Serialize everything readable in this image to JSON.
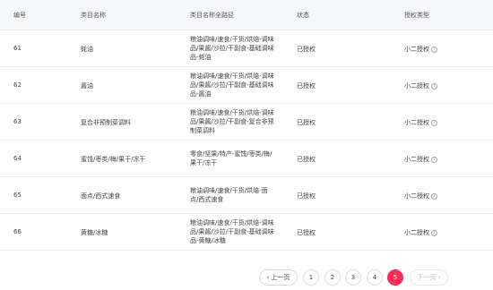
{
  "headers": {
    "id": "编号",
    "name": "类目名称",
    "path": "类目名称全路径",
    "status": "状态",
    "auth": "授权类型"
  },
  "rows": [
    {
      "id": "61",
      "name": "蚝油",
      "path_lines": [
        "粮油调味/速食/干货/烘焙-调味",
        "品/果酱/沙拉/干副食-基础调味",
        "品-蚝油"
      ],
      "status": "已授权",
      "auth": "小二授权"
    },
    {
      "id": "62",
      "name": "酱油",
      "path_lines": [
        "粮油调味/速食/干货/烘焙-调味",
        "品/果酱/沙拉/干副食-基础调味",
        "品-酱油"
      ],
      "status": "已授权",
      "auth": "小二授权"
    },
    {
      "id": "63",
      "name": "复合非预制菜调料",
      "path_lines": [
        "粮油调味/速食/干货/烘焙-调味",
        "品/果酱/沙拉/干副食-复合非预",
        "制菜调料"
      ],
      "status": "已授权",
      "auth": "小二授权"
    },
    {
      "id": "64",
      "name": "蜜饯/枣类/梅/果干/冻干",
      "path_lines": [
        "零食/坚果/特产-蜜饯/枣类/梅/",
        "果干/冻干"
      ],
      "status": "已授权",
      "auth": "小二授权"
    },
    {
      "id": "65",
      "name": "面点/西式速食",
      "path_lines": [
        "粮油调味/速食/干货/烘焙-面",
        "点/西式速食"
      ],
      "status": "已授权",
      "auth": "小二授权"
    },
    {
      "id": "66",
      "name": "黄糖/冰糖",
      "path_lines": [
        "粮油调味/速食/干货/烘焙-调味",
        "品/果酱/沙拉/干副食-基础调味",
        "品-黄糖/冰糖"
      ],
      "status": "已授权",
      "auth": "小二授权"
    }
  ],
  "pagination": {
    "prev": "‹ 上一页",
    "pages": [
      "1",
      "2",
      "3",
      "4",
      "5"
    ],
    "current": "5",
    "next": "下一页 ›"
  },
  "icons": {
    "help": "?"
  },
  "colors": {
    "accent": "#ff2e56",
    "header_bg": "#f7f8fa"
  }
}
